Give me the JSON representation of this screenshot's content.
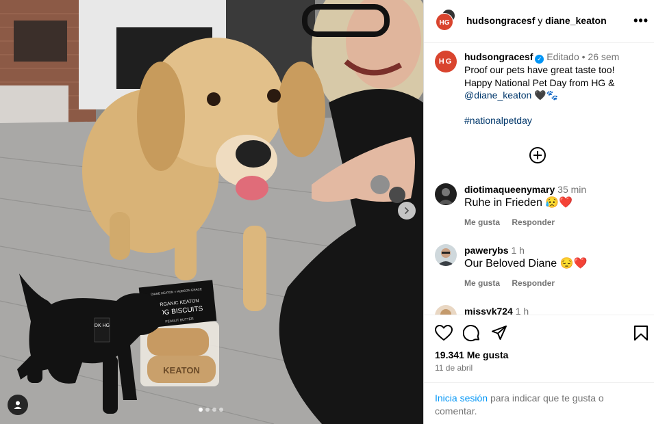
{
  "header": {
    "author": "hudsongracesf",
    "conjunction": "y",
    "coauthor": "diane_keaton",
    "avatar_text": "HG"
  },
  "caption": {
    "username": "hudsongracesf",
    "edited": "Editado",
    "separator": "•",
    "time": "26 sem",
    "line1": "Proof our pets have great taste too!",
    "line2": "Happy National Pet Day from HG &",
    "mention": "@diane_keaton",
    "emojis": "🖤🐾",
    "hashtag": "#nationalpetday"
  },
  "comments": [
    {
      "username": "diotimaqueenymary",
      "time": "35 min",
      "text": "Ruhe in Frieden",
      "emojis": "😥❤️",
      "like_label": "Me gusta",
      "reply_label": "Responder"
    },
    {
      "username": "pawerybs",
      "time": "1 h",
      "text": "Our Beloved Diane",
      "emojis": "😔❤️",
      "like_label": "Me gusta",
      "reply_label": "Responder"
    },
    {
      "username": "missyk724",
      "time": "1 h",
      "text": "",
      "emojis": "",
      "like_label": "",
      "reply_label": ""
    }
  ],
  "footer": {
    "likes": "19.341 Me gusta",
    "date": "11 de abril",
    "login_link": "Inicia sesión",
    "login_text": "para indicar que te gusta o comentar."
  },
  "photo": {
    "box_brand": "DIANE KEATON × HUDSON GRACE",
    "box_title1": "ORGANIC KEATON",
    "box_title2": "DOG BISCUITS",
    "box_flavor": "PEANUT BUTTER",
    "biscuit_text": "KEATON",
    "tag_text": "DK HG"
  },
  "colors": {
    "brand": "#d9442e",
    "link": "#00376b",
    "blue": "#0095f6",
    "muted": "#737373"
  },
  "carousel": {
    "count": 4,
    "active": 1
  }
}
